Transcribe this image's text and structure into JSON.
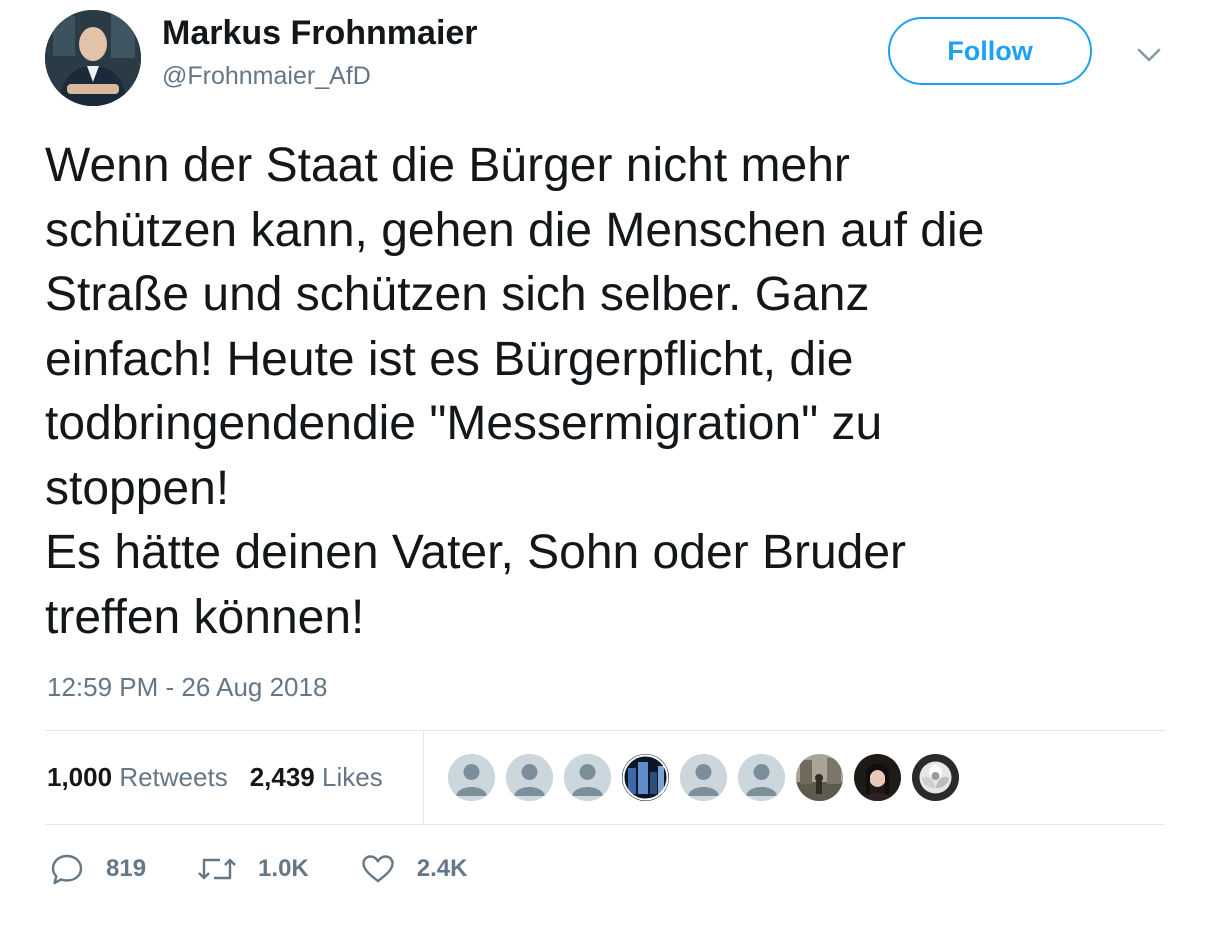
{
  "author": {
    "display_name": "Markus Frohnmaier",
    "handle": "@Frohnmaier_AfD"
  },
  "follow_label": "Follow",
  "tweet": {
    "text": "Wenn der Staat die Bürger nicht mehr\nschützen kann, gehen die Menschen auf die\nStraße und schützen sich selber. Ganz\neinfach! Heute ist es Bürgerpflicht, die\ntodbringendendie \"Messermigration\" zu\nstoppen!\nEs hätte deinen Vater, Sohn oder Bruder\ntreffen können!",
    "timestamp": "12:59 PM - 26 Aug 2018"
  },
  "stats": {
    "retweets_count": "1,000",
    "retweets_label": "Retweets",
    "likes_count": "2,439",
    "likes_label": "Likes"
  },
  "likers": [
    "default-avatar",
    "default-avatar",
    "default-avatar",
    "photo-avatar",
    "default-avatar",
    "default-avatar",
    "photo-avatar",
    "photo-avatar",
    "rose-photo-avatar"
  ],
  "actions": {
    "replies": "819",
    "retweets": "1.0K",
    "likes": "2.4K"
  },
  "colors": {
    "accent": "#1da1f2",
    "text": "#14171a",
    "secondary": "#657786",
    "divider": "#e1e8ed"
  }
}
